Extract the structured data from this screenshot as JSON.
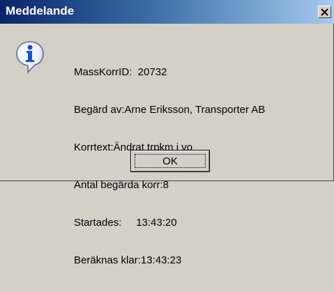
{
  "window": {
    "title": "Meddelande",
    "close_label": "Close"
  },
  "icon": {
    "name": "information-icon",
    "glyph": "i",
    "color": "#1a4fd6"
  },
  "message": {
    "lines": [
      "MassKorrID:  20732",
      "Begärd av:Arne Eriksson, Transporter AB",
      "Korrtext:Ändrat trpkm i vo",
      "Antal begärda korr:8",
      "Startades:     13:43:20",
      "Beräknas klar:13:43:23"
    ]
  },
  "buttons": {
    "ok_label": "OK"
  },
  "colors": {
    "title_gradient_start": "#0a246a",
    "title_gradient_end": "#a6caf0",
    "dialog_background": "#d4d0c8"
  }
}
